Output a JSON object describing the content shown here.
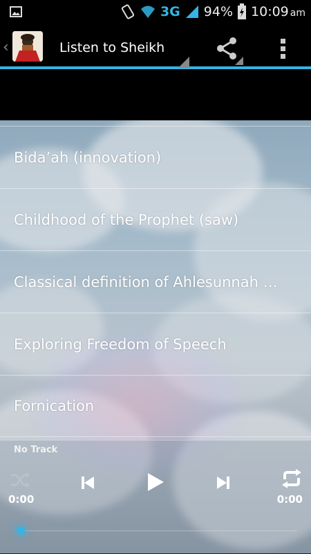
{
  "status_bar": {
    "network": "3G",
    "battery": "94%",
    "time": "10:09",
    "ampm": "am"
  },
  "action_bar": {
    "title": "Listen to Sheikh H",
    "accent_color": "#33b5e5"
  },
  "list": {
    "items": [
      {
        "label": "Bida’ah (innovation)"
      },
      {
        "label": "Childhood of the Prophet (saw)"
      },
      {
        "label": "Classical definition of Ahlesunnah wal Jamaah"
      },
      {
        "label": "Exploring Freedom of Speech"
      },
      {
        "label": "Fornication"
      }
    ]
  },
  "player": {
    "track": "No Track",
    "elapsed": "0:00",
    "duration": "0:00",
    "progress": 0
  },
  "icons": {
    "shuffle": "shuffle-icon",
    "previous": "skip-previous-icon",
    "play": "play-icon",
    "next": "skip-next-icon",
    "repeat": "repeat-icon",
    "share": "share-icon",
    "overflow": "overflow-menu-icon"
  }
}
